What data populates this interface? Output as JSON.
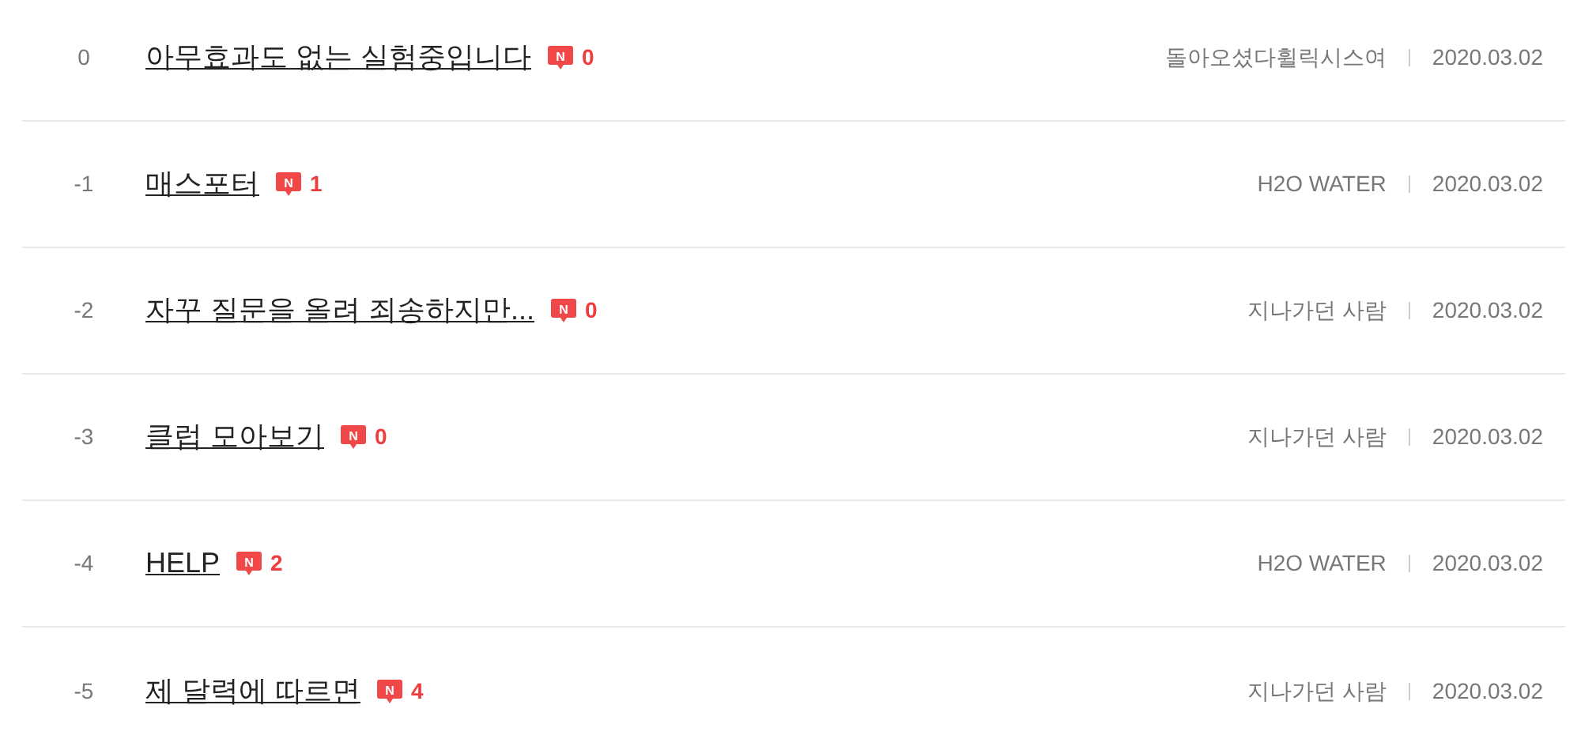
{
  "posts": [
    {
      "number": "0",
      "title": "아무효과도 없는 실험중입니다",
      "new_mark": "N",
      "comments": "0",
      "author": "돌아오셨다휠릭시스여",
      "date": "2020.03.02"
    },
    {
      "number": "-1",
      "title": "매스포터",
      "new_mark": "N",
      "comments": "1",
      "author": "H2O WATER",
      "date": "2020.03.02"
    },
    {
      "number": "-2",
      "title": "자꾸 질문을 올려 죄송하지만...",
      "new_mark": "N",
      "comments": "0",
      "author": "지나가던 사람",
      "date": "2020.03.02"
    },
    {
      "number": "-3",
      "title": "클럽 모아보기",
      "new_mark": "N",
      "comments": "0",
      "author": "지나가던 사람",
      "date": "2020.03.02"
    },
    {
      "number": "-4",
      "title": "HELP",
      "new_mark": "N",
      "comments": "2",
      "author": "H2O WATER",
      "date": "2020.03.02"
    },
    {
      "number": "-5",
      "title": "제 달력에 따르면",
      "new_mark": "N",
      "comments": "4",
      "author": "지나가던 사람",
      "date": "2020.03.02"
    }
  ]
}
